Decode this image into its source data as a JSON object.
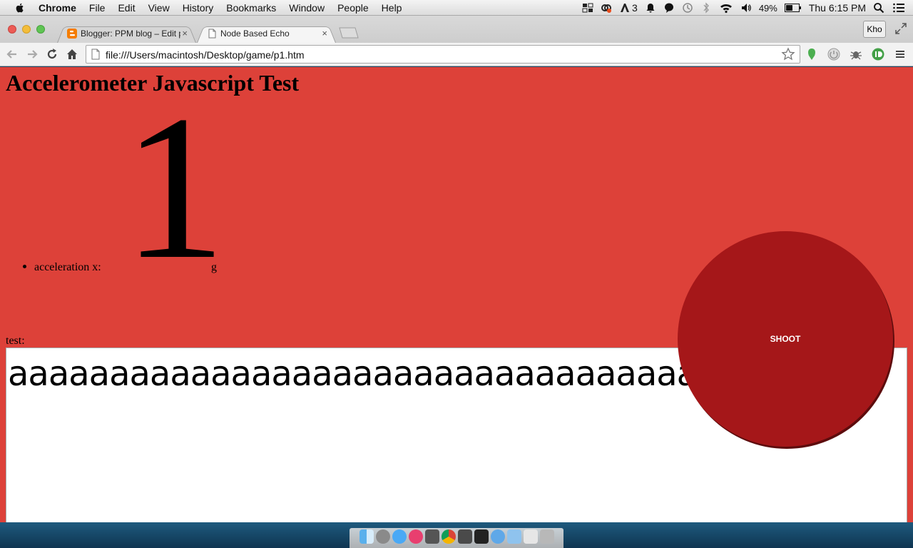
{
  "menubar": {
    "app": "Chrome",
    "items": [
      "File",
      "Edit",
      "View",
      "History",
      "Bookmarks",
      "Window",
      "People",
      "Help"
    ],
    "status": {
      "adobe_count": "3",
      "battery": "49%",
      "clock": "Thu 6:15 PM"
    }
  },
  "tabs": [
    {
      "title": "Blogger: PPM blog – Edit p",
      "close": "×"
    },
    {
      "title": "Node Based Echo",
      "close": "×"
    }
  ],
  "profile": {
    "label": "Kho"
  },
  "toolbar": {
    "url": "file:///Users/macintosh/Desktop/game/p1.htm"
  },
  "page": {
    "heading": "Accelerometer Javascript Test",
    "accel_label": "acceleration x:",
    "accel_value": "1",
    "accel_unit": "g",
    "test_label": "test:",
    "test_text": "aaaaaaaaaaaaaaaaaaaaaaaaaaaaaaaaaaa",
    "shoot_label": "SHOOT"
  },
  "colors": {
    "page_bg": "#dd4139",
    "shoot_bg": "#a51719",
    "tab_blogger_icon": "#f57d00",
    "ext_green": "#4caf50"
  },
  "icons": [
    "apple-icon",
    "back-icon",
    "forward-icon",
    "reload-icon",
    "home-icon",
    "page-icon",
    "star-icon",
    "wifi-icon",
    "search-icon",
    "notification-icon"
  ]
}
